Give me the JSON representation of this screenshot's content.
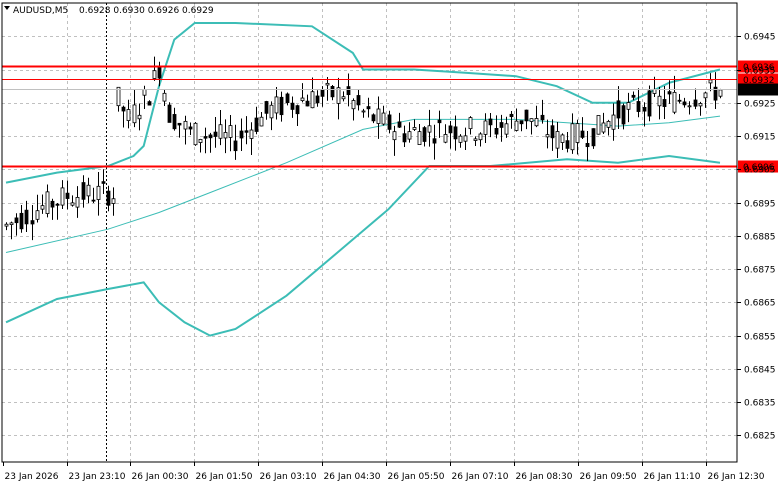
{
  "header": {
    "symbol": "AUDUSD,M5",
    "ohlc": "0.6928 0.6930 0.6926 0.6929"
  },
  "chart_data": {
    "type": "candlestick",
    "symbol": "AUDUSD",
    "timeframe": "M5",
    "ylim": [
      0.6817,
      0.6955
    ],
    "y_ticks": [
      "0.6945",
      "0.6935",
      "0.6925",
      "0.6915",
      "0.6905",
      "0.6895",
      "0.6885",
      "0.6875",
      "0.6865",
      "0.6855",
      "0.6845",
      "0.6835",
      "0.6825"
    ],
    "x_ticks": [
      "23 Jan 2026",
      "23 Jan 23:10",
      "26 Jan 00:30",
      "26 Jan 01:50",
      "26 Jan 03:10",
      "26 Jan 04:30",
      "26 Jan 05:50",
      "26 Jan 07:10",
      "26 Jan 08:30",
      "26 Jan 09:50",
      "26 Jan 11:10",
      "26 Jan 12:30"
    ],
    "bar_count": 141,
    "grid": true,
    "price_levels": [
      {
        "label": "0.6936",
        "value": 0.6936,
        "color": "#ff0000",
        "kind": "resistance"
      },
      {
        "label": "0.6932",
        "value": 0.6932,
        "color": "#ff0000",
        "kind": "price"
      },
      {
        "label": "0.6929",
        "value": 0.6929,
        "color": "#000000",
        "kind": "bid"
      },
      {
        "label": "0.6906",
        "value": 0.6906,
        "color": "#ff0000",
        "kind": "support"
      }
    ],
    "session_separator": "23 Jan 23:10",
    "bollinger": {
      "color": "#3cbdb6",
      "upper": [
        [
          0,
          0.6901
        ],
        [
          10,
          0.6904
        ],
        [
          20,
          0.6906
        ],
        [
          25,
          0.6909
        ],
        [
          27,
          0.6912
        ],
        [
          30,
          0.693
        ],
        [
          33,
          0.6944
        ],
        [
          37,
          0.6949
        ],
        [
          45,
          0.6949
        ],
        [
          60,
          0.6948
        ],
        [
          68,
          0.694
        ],
        [
          70,
          0.6935
        ],
        [
          80,
          0.6935
        ],
        [
          90,
          0.6934
        ],
        [
          100,
          0.6933
        ],
        [
          108,
          0.693
        ],
        [
          115,
          0.6925
        ],
        [
          122,
          0.6925
        ],
        [
          130,
          0.6931
        ],
        [
          140,
          0.6935
        ]
      ],
      "middle": [
        [
          0,
          0.688
        ],
        [
          20,
          0.6887
        ],
        [
          30,
          0.6892
        ],
        [
          40,
          0.6898
        ],
        [
          55,
          0.6907
        ],
        [
          70,
          0.6917
        ],
        [
          80,
          0.692
        ],
        [
          90,
          0.692
        ],
        [
          100,
          0.692
        ],
        [
          110,
          0.6919
        ],
        [
          120,
          0.6918
        ],
        [
          130,
          0.6919
        ],
        [
          140,
          0.6921
        ]
      ],
      "lower": [
        [
          0,
          0.6859
        ],
        [
          10,
          0.6866
        ],
        [
          20,
          0.6869
        ],
        [
          27,
          0.6871
        ],
        [
          30,
          0.6865
        ],
        [
          35,
          0.6859
        ],
        [
          40,
          0.6855
        ],
        [
          45,
          0.6857
        ],
        [
          55,
          0.6867
        ],
        [
          65,
          0.688
        ],
        [
          75,
          0.6893
        ],
        [
          83,
          0.6906
        ],
        [
          95,
          0.6906
        ],
        [
          110,
          0.6908
        ],
        [
          120,
          0.6907
        ],
        [
          130,
          0.6909
        ],
        [
          140,
          0.6907
        ]
      ]
    }
  }
}
